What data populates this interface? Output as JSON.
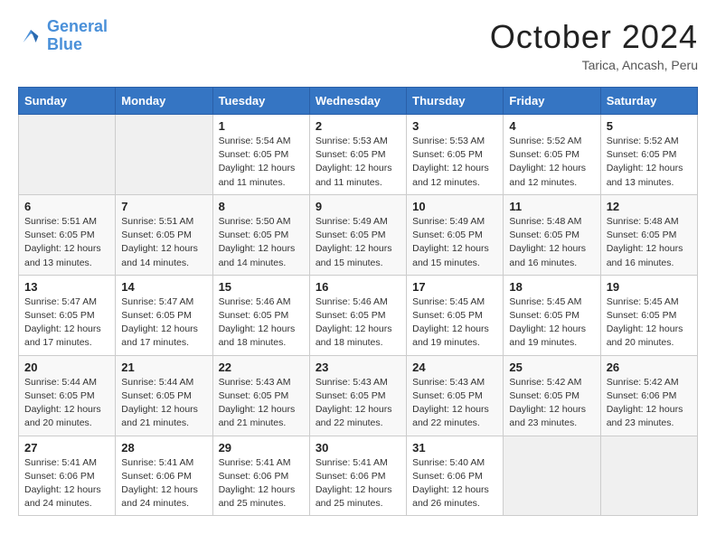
{
  "header": {
    "logo_line1": "General",
    "logo_line2": "Blue",
    "month": "October 2024",
    "location": "Tarica, Ancash, Peru"
  },
  "weekdays": [
    "Sunday",
    "Monday",
    "Tuesday",
    "Wednesday",
    "Thursday",
    "Friday",
    "Saturday"
  ],
  "weeks": [
    [
      {
        "day": "",
        "empty": true
      },
      {
        "day": "",
        "empty": true
      },
      {
        "day": "1",
        "sunrise": "Sunrise: 5:54 AM",
        "sunset": "Sunset: 6:05 PM",
        "daylight": "Daylight: 12 hours and 11 minutes."
      },
      {
        "day": "2",
        "sunrise": "Sunrise: 5:53 AM",
        "sunset": "Sunset: 6:05 PM",
        "daylight": "Daylight: 12 hours and 11 minutes."
      },
      {
        "day": "3",
        "sunrise": "Sunrise: 5:53 AM",
        "sunset": "Sunset: 6:05 PM",
        "daylight": "Daylight: 12 hours and 12 minutes."
      },
      {
        "day": "4",
        "sunrise": "Sunrise: 5:52 AM",
        "sunset": "Sunset: 6:05 PM",
        "daylight": "Daylight: 12 hours and 12 minutes."
      },
      {
        "day": "5",
        "sunrise": "Sunrise: 5:52 AM",
        "sunset": "Sunset: 6:05 PM",
        "daylight": "Daylight: 12 hours and 13 minutes."
      }
    ],
    [
      {
        "day": "6",
        "sunrise": "Sunrise: 5:51 AM",
        "sunset": "Sunset: 6:05 PM",
        "daylight": "Daylight: 12 hours and 13 minutes."
      },
      {
        "day": "7",
        "sunrise": "Sunrise: 5:51 AM",
        "sunset": "Sunset: 6:05 PM",
        "daylight": "Daylight: 12 hours and 14 minutes."
      },
      {
        "day": "8",
        "sunrise": "Sunrise: 5:50 AM",
        "sunset": "Sunset: 6:05 PM",
        "daylight": "Daylight: 12 hours and 14 minutes."
      },
      {
        "day": "9",
        "sunrise": "Sunrise: 5:49 AM",
        "sunset": "Sunset: 6:05 PM",
        "daylight": "Daylight: 12 hours and 15 minutes."
      },
      {
        "day": "10",
        "sunrise": "Sunrise: 5:49 AM",
        "sunset": "Sunset: 6:05 PM",
        "daylight": "Daylight: 12 hours and 15 minutes."
      },
      {
        "day": "11",
        "sunrise": "Sunrise: 5:48 AM",
        "sunset": "Sunset: 6:05 PM",
        "daylight": "Daylight: 12 hours and 16 minutes."
      },
      {
        "day": "12",
        "sunrise": "Sunrise: 5:48 AM",
        "sunset": "Sunset: 6:05 PM",
        "daylight": "Daylight: 12 hours and 16 minutes."
      }
    ],
    [
      {
        "day": "13",
        "sunrise": "Sunrise: 5:47 AM",
        "sunset": "Sunset: 6:05 PM",
        "daylight": "Daylight: 12 hours and 17 minutes."
      },
      {
        "day": "14",
        "sunrise": "Sunrise: 5:47 AM",
        "sunset": "Sunset: 6:05 PM",
        "daylight": "Daylight: 12 hours and 17 minutes."
      },
      {
        "day": "15",
        "sunrise": "Sunrise: 5:46 AM",
        "sunset": "Sunset: 6:05 PM",
        "daylight": "Daylight: 12 hours and 18 minutes."
      },
      {
        "day": "16",
        "sunrise": "Sunrise: 5:46 AM",
        "sunset": "Sunset: 6:05 PM",
        "daylight": "Daylight: 12 hours and 18 minutes."
      },
      {
        "day": "17",
        "sunrise": "Sunrise: 5:45 AM",
        "sunset": "Sunset: 6:05 PM",
        "daylight": "Daylight: 12 hours and 19 minutes."
      },
      {
        "day": "18",
        "sunrise": "Sunrise: 5:45 AM",
        "sunset": "Sunset: 6:05 PM",
        "daylight": "Daylight: 12 hours and 19 minutes."
      },
      {
        "day": "19",
        "sunrise": "Sunrise: 5:45 AM",
        "sunset": "Sunset: 6:05 PM",
        "daylight": "Daylight: 12 hours and 20 minutes."
      }
    ],
    [
      {
        "day": "20",
        "sunrise": "Sunrise: 5:44 AM",
        "sunset": "Sunset: 6:05 PM",
        "daylight": "Daylight: 12 hours and 20 minutes."
      },
      {
        "day": "21",
        "sunrise": "Sunrise: 5:44 AM",
        "sunset": "Sunset: 6:05 PM",
        "daylight": "Daylight: 12 hours and 21 minutes."
      },
      {
        "day": "22",
        "sunrise": "Sunrise: 5:43 AM",
        "sunset": "Sunset: 6:05 PM",
        "daylight": "Daylight: 12 hours and 21 minutes."
      },
      {
        "day": "23",
        "sunrise": "Sunrise: 5:43 AM",
        "sunset": "Sunset: 6:05 PM",
        "daylight": "Daylight: 12 hours and 22 minutes."
      },
      {
        "day": "24",
        "sunrise": "Sunrise: 5:43 AM",
        "sunset": "Sunset: 6:05 PM",
        "daylight": "Daylight: 12 hours and 22 minutes."
      },
      {
        "day": "25",
        "sunrise": "Sunrise: 5:42 AM",
        "sunset": "Sunset: 6:05 PM",
        "daylight": "Daylight: 12 hours and 23 minutes."
      },
      {
        "day": "26",
        "sunrise": "Sunrise: 5:42 AM",
        "sunset": "Sunset: 6:06 PM",
        "daylight": "Daylight: 12 hours and 23 minutes."
      }
    ],
    [
      {
        "day": "27",
        "sunrise": "Sunrise: 5:41 AM",
        "sunset": "Sunset: 6:06 PM",
        "daylight": "Daylight: 12 hours and 24 minutes."
      },
      {
        "day": "28",
        "sunrise": "Sunrise: 5:41 AM",
        "sunset": "Sunset: 6:06 PM",
        "daylight": "Daylight: 12 hours and 24 minutes."
      },
      {
        "day": "29",
        "sunrise": "Sunrise: 5:41 AM",
        "sunset": "Sunset: 6:06 PM",
        "daylight": "Daylight: 12 hours and 25 minutes."
      },
      {
        "day": "30",
        "sunrise": "Sunrise: 5:41 AM",
        "sunset": "Sunset: 6:06 PM",
        "daylight": "Daylight: 12 hours and 25 minutes."
      },
      {
        "day": "31",
        "sunrise": "Sunrise: 5:40 AM",
        "sunset": "Sunset: 6:06 PM",
        "daylight": "Daylight: 12 hours and 26 minutes."
      },
      {
        "day": "",
        "empty": true
      },
      {
        "day": "",
        "empty": true
      }
    ]
  ]
}
